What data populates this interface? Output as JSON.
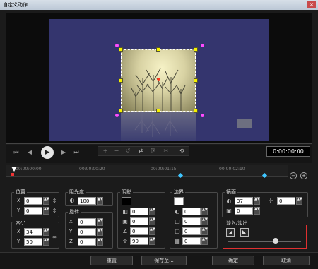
{
  "window": {
    "title": "自定义动作",
    "close_label": "×"
  },
  "preview": {
    "center_marker": "center",
    "handle_color": "#f6f200",
    "magenta_handle_color": "#ff4bff"
  },
  "playback": {
    "timecode": "0:00:00:00",
    "buttons": [
      "home",
      "prev-frame",
      "play",
      "next-frame",
      "end"
    ],
    "toolbar_icons": [
      "add-keyframe",
      "remove-keyframe",
      "reverse",
      "swap",
      "copy",
      "paste",
      "reset"
    ]
  },
  "timeline": {
    "labels": [
      "00:00:00:00",
      "00:00:00:20",
      "00:00:01:15",
      "00:00:02:10"
    ],
    "zoom_out": "−",
    "zoom_in": "+"
  },
  "position": {
    "label": "位置",
    "x_label": "X",
    "x_value": "0",
    "y_label": "Y",
    "y_value": "0"
  },
  "size": {
    "label": "大小",
    "x_label": "X",
    "x_value": "34",
    "y_label": "Y",
    "y_value": "50"
  },
  "opacity": {
    "label": "阻光度",
    "value": "100"
  },
  "rotation": {
    "label": "旋转",
    "x_label": "X",
    "x_value": "0",
    "y_label": "Y",
    "y_value": "0",
    "z_label": "Z",
    "z_value": "0"
  },
  "shadow": {
    "label": "阴影",
    "color": "#000000",
    "values": [
      "0",
      "0",
      "0",
      "90"
    ]
  },
  "border": {
    "label": "边界",
    "color": "#ffffff",
    "values": [
      "0",
      "0",
      "0",
      "0"
    ]
  },
  "mirror": {
    "label": "镜面",
    "value1": "37",
    "value2": "0",
    "value3": "0"
  },
  "ease": {
    "label": "淡入/淡出",
    "level": 0.65
  },
  "bottom": {
    "reset": "重置",
    "save_to": "保存至...",
    "ok": "确定",
    "cancel": "取消"
  }
}
